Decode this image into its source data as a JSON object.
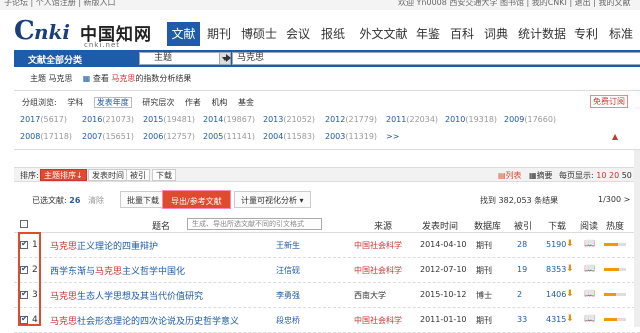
{
  "top_strip": {
    "left": "子论坛 | 个人馆注册 | 新版入口",
    "right": "欢迎 Yn0008 西安交通大学 图书馆 | 我的CNKI | 退出 | 我的文献"
  },
  "logo": {
    "c": "C",
    "nki": "nki",
    "cn": "中国知网",
    "net": "cnki.net"
  },
  "nav": [
    "文献",
    "期刊",
    "博硕士",
    "会议",
    "报纸",
    "外文文献",
    "年鉴",
    "百科",
    "词典",
    "统计数据",
    "专利",
    "标准"
  ],
  "search": {
    "category": "文献全部分类",
    "field": "主题",
    "query": "马克思"
  },
  "crumb": {
    "prefix": "主题",
    "topic": "马克思",
    "view": "查看",
    "link": "马克思",
    "suffix": "的指数分析结果"
  },
  "grouping": {
    "label": "分组浏览:",
    "items": [
      "学科",
      "发表年度",
      "研究层次",
      "作者",
      "机构",
      "基金"
    ],
    "subscribe": "免费订阅"
  },
  "years": [
    {
      "y": "2017",
      "c": "(5617)"
    },
    {
      "y": "2016",
      "c": "(21073)"
    },
    {
      "y": "2015",
      "c": "(19481)"
    },
    {
      "y": "2014",
      "c": "(19867)"
    },
    {
      "y": "2013",
      "c": "(21052)"
    },
    {
      "y": "2012",
      "c": "(21779)"
    },
    {
      "y": "2011",
      "c": "(22034)"
    },
    {
      "y": "2010",
      "c": "(19318)"
    },
    {
      "y": "2009",
      "c": "(17660)"
    },
    {
      "y": "2008",
      "c": "(17118)"
    },
    {
      "y": "2007",
      "c": "(15651)"
    },
    {
      "y": "2006",
      "c": "(12757)"
    },
    {
      "y": "2005",
      "c": "(11141)"
    },
    {
      "y": "2004",
      "c": "(11583)"
    },
    {
      "y": "2003",
      "c": "(11319)"
    },
    {
      "y": ">>",
      "c": ""
    }
  ],
  "sort": {
    "label": "排序:",
    "buttons": [
      "主题排序↓",
      "发表时间",
      "被引",
      "下载"
    ],
    "list_view": "列表",
    "abstract_view": "摘要",
    "per_page_label": "每页显示:",
    "per_page": [
      "10",
      "20",
      "50"
    ]
  },
  "toolbar": {
    "selected_label": "已选文献:",
    "selected_count": "26",
    "clear": "清除",
    "batch": "批量下载",
    "export": "导出/参考文献",
    "visualize": "计量可视化分析",
    "found": "找到 382,053 条结果",
    "pager": "1/300 >"
  },
  "tooltip": "生成、导出所选文献不同的引文格式",
  "headers": [
    "题名",
    "作者",
    "来源",
    "发表时间",
    "数据库",
    "被引",
    "下载",
    "阅读",
    "热度"
  ],
  "rows": [
    {
      "n": "1",
      "hl": "马克思",
      "rest": "正义理论的四重辩护",
      "pre": "",
      "author": "王新生",
      "source": "中国社会科学",
      "date": "2014-04-10",
      "db": "期刊",
      "cite": "28",
      "dl": "5190",
      "heat": 0.65
    },
    {
      "n": "2",
      "hl": "马克思",
      "rest": "主义哲学中国化",
      "pre": "西学东渐与",
      "author": "汪信砚",
      "source": "中国社会科学",
      "date": "2012-07-10",
      "db": "期刊",
      "cite": "19",
      "dl": "8353",
      "heat": 0.7
    },
    {
      "n": "3",
      "hl": "马克思",
      "rest": "生态人学思想及其当代价值研究",
      "pre": "",
      "author": "李勇强",
      "source": "西南大学",
      "date": "2015-10-12",
      "db": "博士",
      "cite": "2",
      "dl": "1406",
      "heat": 0.55
    },
    {
      "n": "4",
      "hl": "马克思",
      "rest": "社会形态理论的四次论说及历史哲学意义",
      "pre": "",
      "author": "段忠桥",
      "source": "中国社会科学",
      "date": "2011-01-10",
      "db": "期刊",
      "cite": "33",
      "dl": "4315",
      "heat": 0.6
    }
  ]
}
